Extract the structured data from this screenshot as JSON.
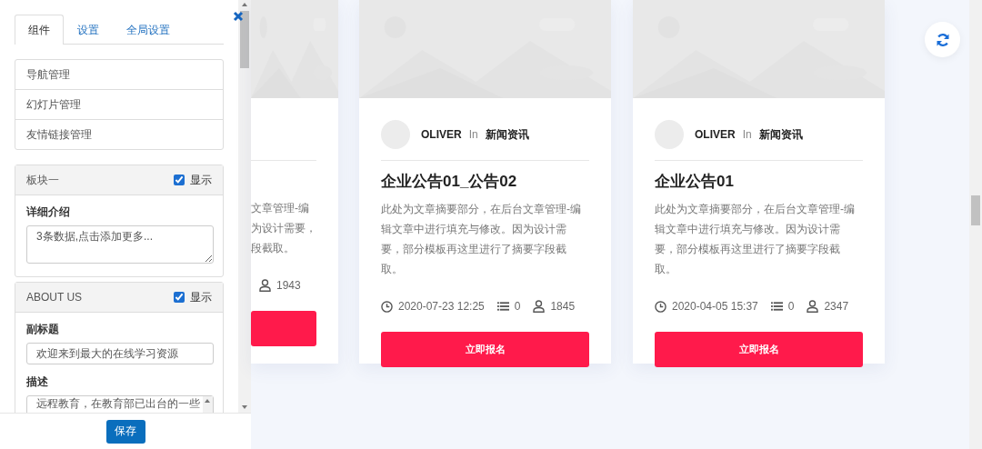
{
  "panel": {
    "tabs": [
      {
        "label": "组件",
        "selected": true
      },
      {
        "label": "设置",
        "selected": false
      },
      {
        "label": "全局设置",
        "selected": false
      }
    ],
    "menu_items": [
      "导航管理",
      "幻灯片管理",
      "友情链接管理"
    ],
    "sections": [
      {
        "title": "板块一",
        "show_label": "显示",
        "show": true,
        "fields": [
          {
            "label": "详细介绍",
            "kind": "textarea",
            "value": "3条数据,点击添加更多..."
          }
        ]
      },
      {
        "title": "ABOUT US",
        "show_label": "显示",
        "show": true,
        "fields": [
          {
            "label": "副标题",
            "kind": "input",
            "value": "欢迎来到最大的在线学习资源"
          },
          {
            "label": "描述",
            "kind": "textarea",
            "value": "远程教育，在教育部已出台的一些"
          }
        ]
      }
    ],
    "save_button": "保存"
  },
  "cards": [
    {
      "kind": "clipped",
      "excerpt_lines": [
        "文章管理-编",
        "为设计需要，",
        "段截取。"
      ],
      "views": "1943"
    },
    {
      "kind": "full",
      "author": "OLIVER",
      "in": "In",
      "category": "新闻资讯",
      "title": "企业公告01_公告02",
      "excerpt": "此处为文章摘要部分，在后台文章管理-编辑文章中进行填充与修改。因为设计需要，部分模板再这里进行了摘要字段截取。",
      "date": "2020-07-23 12:25",
      "comments": "0",
      "views": "1845",
      "button": "立即报名"
    },
    {
      "kind": "full",
      "author": "OLIVER",
      "in": "In",
      "category": "新闻资讯",
      "title": "企业公告01",
      "excerpt": "此处为文章摘要部分，在后台文章管理-编辑文章中进行填充与修改。因为设计需要，部分模板再这里进行了摘要字段截取。",
      "date": "2020-04-05 15:37",
      "comments": "0",
      "views": "2347",
      "button": "立即报名"
    }
  ]
}
